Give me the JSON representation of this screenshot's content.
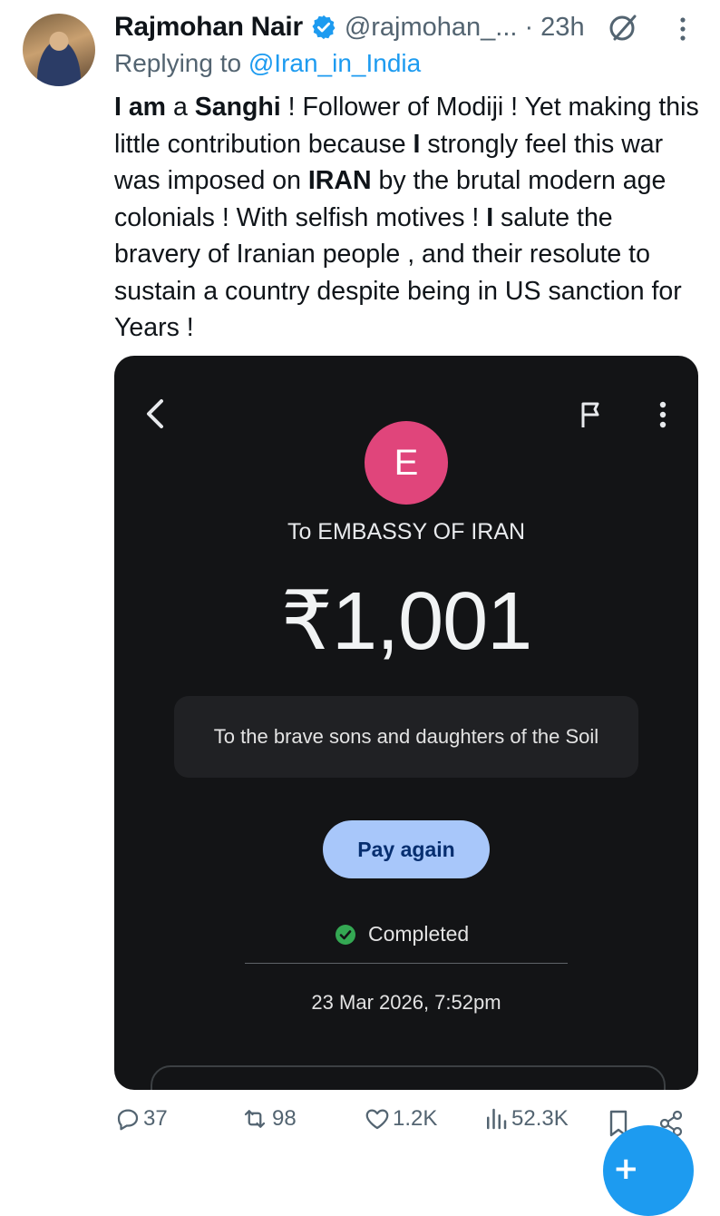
{
  "tweet": {
    "name": "Rajmohan Nair",
    "handle": "@rajmohan_...",
    "time": "· 23h",
    "reply_prefix": "Replying to ",
    "reply_mention": "@Iran_in_India",
    "text_parts": {
      "p1": "I am",
      "p2": " a ",
      "p3": "Sanghi",
      "p4": " ! Follower of Modiji ! Yet making this little contribution because ",
      "p5": "I",
      "p6": " strongly feel this war was imposed on ",
      "p7": "IRAN",
      "p8": " by the brutal modern age colonials ! With selfish motives ! ",
      "p9": "I",
      "p10": " salute the bravery of Iranian people , and their resolute to sustain a country despite being in US sanction for Years !"
    }
  },
  "payment": {
    "avatar_letter": "E",
    "payee": "To EMBASSY OF IRAN",
    "amount": "₹1,001",
    "note": "To the brave sons and daughters of the Soil",
    "pay_again_label": "Pay again",
    "status": "Completed",
    "date": "23 Mar 2026, 7:52pm",
    "avatar_color": "#e0457b",
    "status_color": "#34a853"
  },
  "actions": {
    "replies": "37",
    "reposts": "98",
    "likes": "1.2K",
    "views": "52.3K"
  },
  "colors": {
    "accent": "#1d9bf0",
    "muted": "#536471"
  }
}
